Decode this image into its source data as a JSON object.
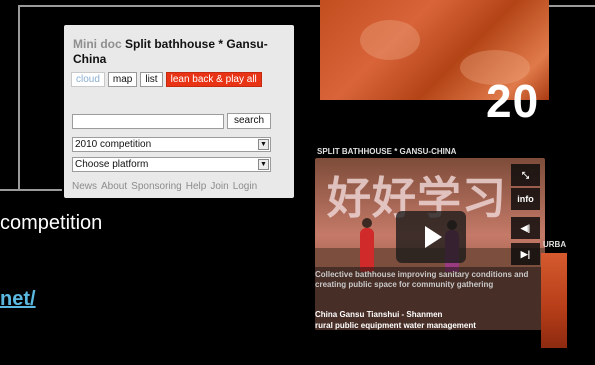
{
  "mini_doc": {
    "brand": "Mini doc",
    "title": "Split bathhouse * Gansu-China",
    "tabs": {
      "cloud": "cloud",
      "map": "map",
      "list": "list",
      "play": "lean back & play all"
    },
    "search": {
      "placeholder": "",
      "button": "search"
    },
    "select_competition": "2010 competition",
    "select_platform": "Choose platform",
    "links": [
      "News",
      "About",
      "Sponsoring",
      "Help",
      "Join",
      "Login"
    ]
  },
  "background": {
    "year_fragment": "20",
    "side_text": "competition",
    "side_link": "net/",
    "right_label": "URBA"
  },
  "project_card": {
    "label": "SPLIT BATHHOUSE * GANSU-CHINA",
    "image_text": "好好学习",
    "controls": {
      "info": "info",
      "prev": "◀|",
      "next": "▶|"
    },
    "description": "Collective bathhouse improving sanitary conditions and creating public space for community gathering",
    "location": "China Gansu Tianshui - Shanmen",
    "tags": "rural  public equipment  water management"
  }
}
